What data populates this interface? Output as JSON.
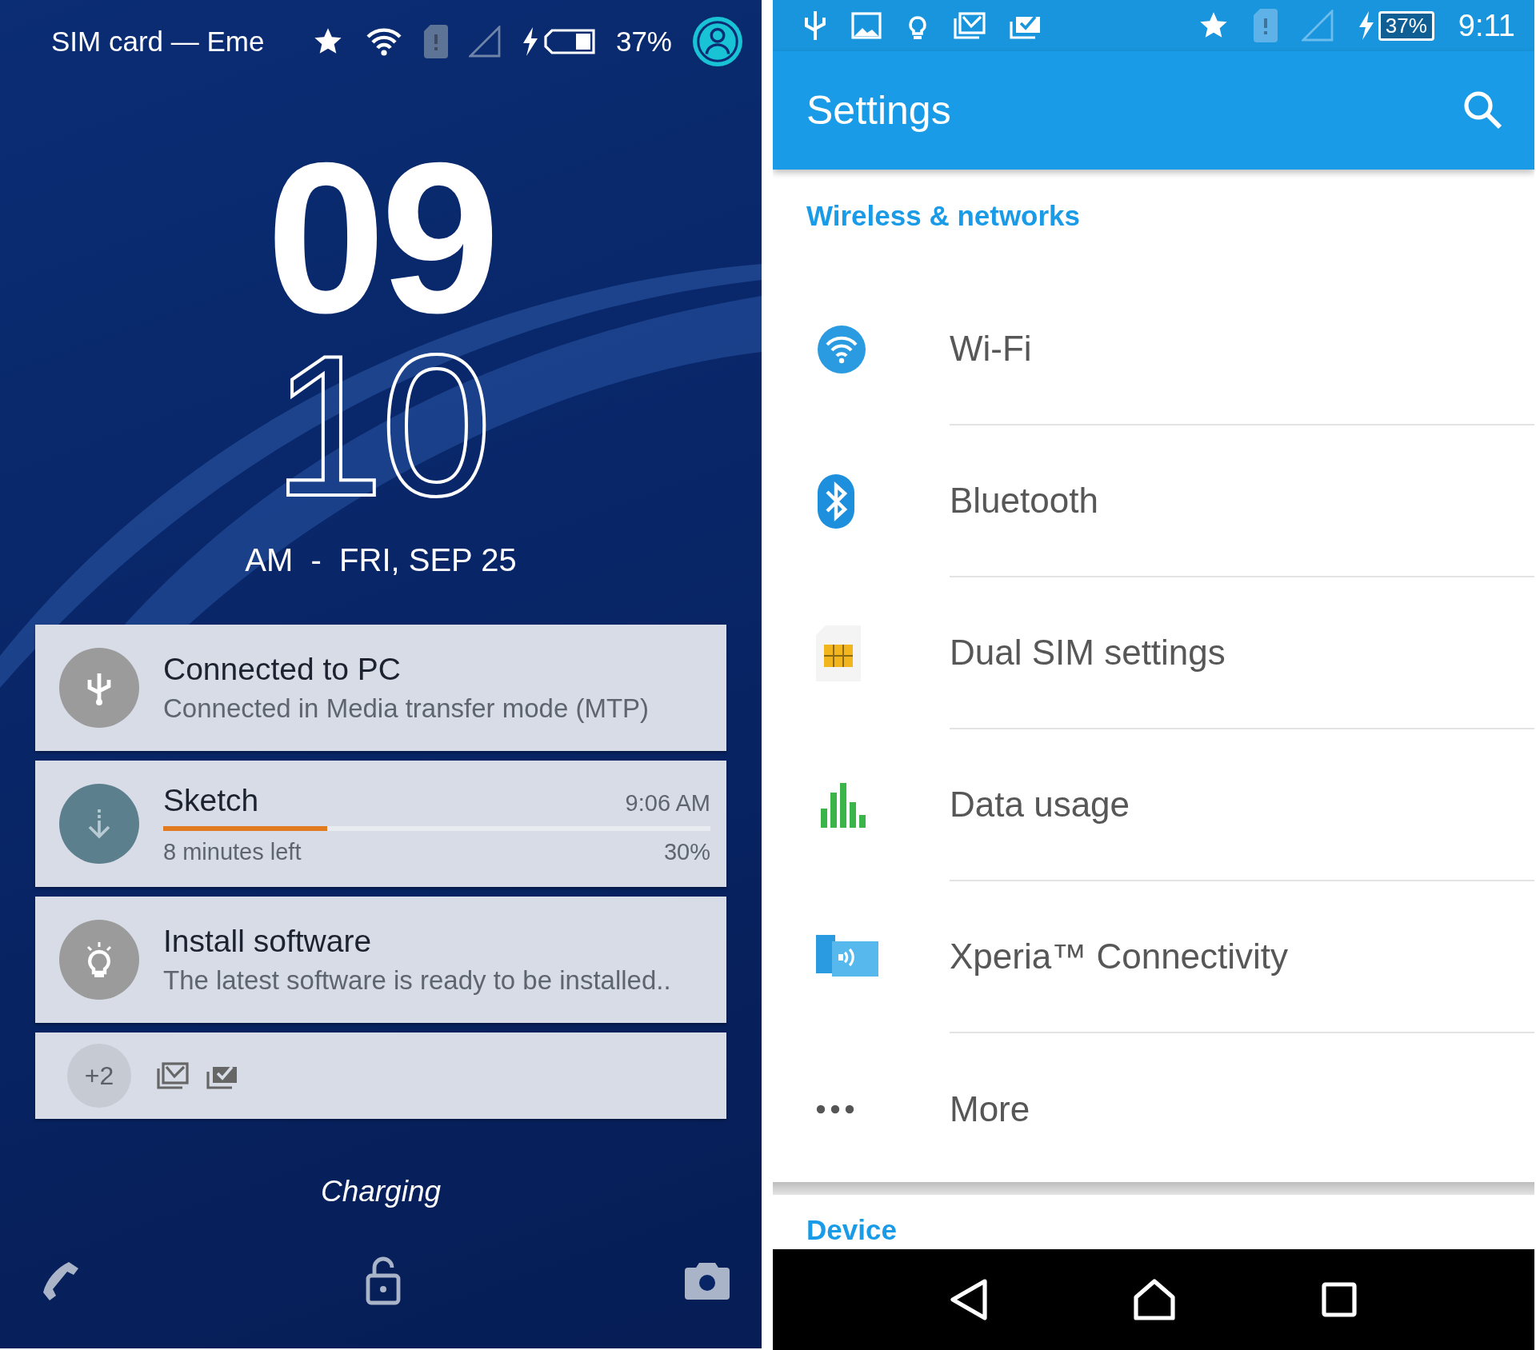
{
  "lock_screen": {
    "status_bar": {
      "carrier_text": "SIM card — Eme",
      "battery_text": "37%"
    },
    "clock": {
      "hours": "09",
      "minutes": "10",
      "date_line": "AM  -  FRI, SEP 25"
    },
    "notifications": [
      {
        "kind": "usb",
        "title": "Connected to PC",
        "text": "Connected in Media transfer mode (MTP)"
      },
      {
        "kind": "download",
        "title": "Sketch",
        "time": "9:06 AM",
        "level": 0.3,
        "subtitle": "8 minutes left",
        "percent": "30%"
      },
      {
        "kind": "install",
        "title": "Install software",
        "text": "The latest software is ready to be installed.."
      },
      {
        "kind": "more",
        "count": "+2"
      }
    ],
    "charging_text": "Charging"
  },
  "settings": {
    "status_bar": {
      "battery_text": "37%",
      "time": "9:11"
    },
    "title": "Settings",
    "section": "Wireless & networks",
    "items": [
      {
        "kind": "wifi",
        "label": "Wi-Fi"
      },
      {
        "kind": "bluetooth",
        "label": "Bluetooth"
      },
      {
        "kind": "sim",
        "label": "Dual SIM settings"
      },
      {
        "kind": "data",
        "label": "Data usage"
      },
      {
        "kind": "xperia",
        "label": "Xperia™ Connectivity"
      },
      {
        "kind": "more",
        "label": "More"
      }
    ],
    "next_section": "Device"
  }
}
